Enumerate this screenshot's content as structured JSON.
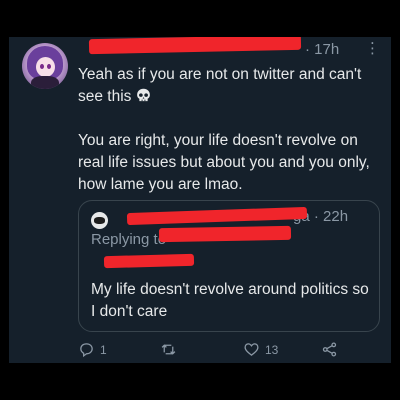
{
  "tweet": {
    "time": "· 17h",
    "text_line1": "Yeah as if you are not on twitter and can't see this",
    "emoji_icon": "skull-icon",
    "text_para2": "You are right, your life doesn't revolve on real life issues but about you and you only, how lame you are lmao."
  },
  "quote": {
    "time": "ga · 22h",
    "replying_prefix": "Replying to",
    "text": "My life doesn't revolve around politics so I don't care"
  },
  "actions": {
    "reply_count": "1",
    "retweet_count": "",
    "like_count": "13"
  },
  "colors": {
    "background": "#15202b",
    "text": "#e7e9ea",
    "muted": "#8b98a5",
    "redaction": "#f0252b"
  }
}
